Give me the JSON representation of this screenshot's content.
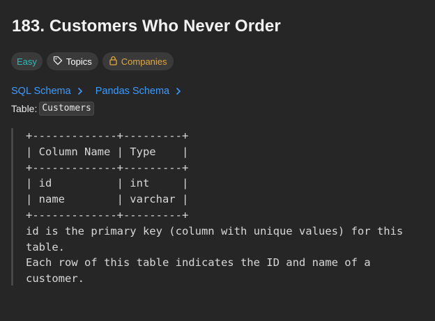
{
  "problem": {
    "title": "183. Customers Who Never Order"
  },
  "tags": {
    "difficulty": "Easy",
    "topics": "Topics",
    "companies": "Companies"
  },
  "colors": {
    "easy": "#2cbbbb",
    "companies": "#e0a93a",
    "link": "#3b9cff",
    "background": "#262626"
  },
  "icons": {
    "topics": "tag-icon",
    "companies": "lock-icon",
    "schema": "chevron-right-icon"
  },
  "schema_links": {
    "sql": "SQL Schema",
    "pandas": "Pandas Schema"
  },
  "table_label": "Table:",
  "table_name": "Customers",
  "schema_block": {
    "border_top": "+-------------+---------+",
    "header": "| Column Name | Type    |",
    "border_mid": "+-------------+---------+",
    "rows": [
      "| id          | int     |",
      "| name        | varchar |"
    ],
    "border_bottom": "+-------------+---------+"
  },
  "description": [
    "id is the primary key (column with unique values) for this",
    "table.",
    "Each row of this table indicates the ID and name of a",
    "customer."
  ]
}
